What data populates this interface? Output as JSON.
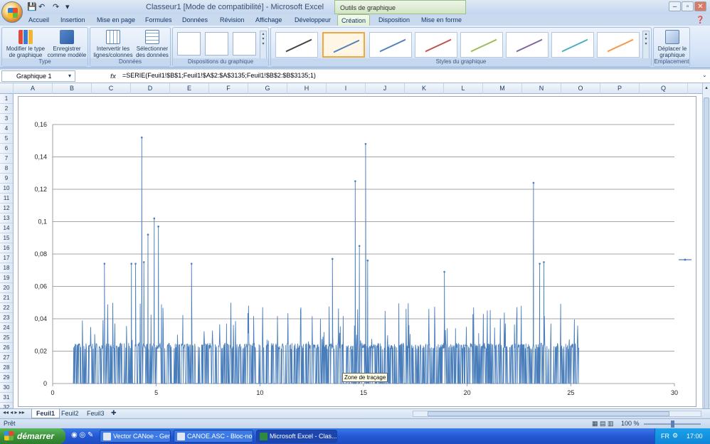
{
  "window": {
    "title": "Classeur1  [Mode de compatibilité] - Microsoft Excel",
    "context_tools": "Outils de graphique"
  },
  "tabs": [
    "Accueil",
    "Insertion",
    "Mise en page",
    "Formules",
    "Données",
    "Révision",
    "Affichage",
    "Développeur",
    "Création",
    "Disposition",
    "Mise en forme"
  ],
  "active_tab": "Création",
  "ribbon": {
    "type": {
      "title": "Type",
      "change_type": "Modifier le type de graphique",
      "save_template": "Enregistrer comme modèle"
    },
    "data": {
      "title": "Données",
      "switch": "Intervertir les lignes/colonnes",
      "select": "Sélectionner des données"
    },
    "layouts": {
      "title": "Dispositions du graphique"
    },
    "styles": {
      "title": "Styles du graphique",
      "colors": [
        "#404040",
        "#4f81bd",
        "#4f81bd",
        "#c0504d",
        "#9bbb59",
        "#8064a2",
        "#4bacc6",
        "#f79646"
      ]
    },
    "location": {
      "title": "Emplacement",
      "move": "Déplacer le graphique"
    }
  },
  "formula_bar": {
    "name_box": "Graphique 1",
    "fx": "fx",
    "formula": "=SERIE(Feuil1!$B$1;Feuil1!$A$2:$A$3135;Feuil1!$B$2:$B$3135;1)"
  },
  "columns": [
    "A",
    "B",
    "C",
    "D",
    "E",
    "F",
    "G",
    "H",
    "I",
    "J",
    "K",
    "L",
    "M",
    "N",
    "O",
    "P",
    "Q"
  ],
  "rows": [
    "1",
    "2",
    "3",
    "4",
    "5",
    "6",
    "7",
    "8",
    "9",
    "10",
    "11",
    "12",
    "13",
    "14",
    "15",
    "16",
    "17",
    "18",
    "19",
    "20",
    "21",
    "22",
    "23",
    "24",
    "25",
    "26",
    "27",
    "28",
    "29",
    "30",
    "31",
    "32"
  ],
  "sheet_tabs": [
    "Feuil1",
    "Feuil2",
    "Feuil3"
  ],
  "status": {
    "ready": "Prêt",
    "zoom": "100 %"
  },
  "taskbar": {
    "start": "démarrer",
    "tasks": [
      "Vector CANoe - Gen...",
      "CANOE.ASC - Bloc-no...",
      "Microsoft Excel - Clas..."
    ],
    "lang": "FR",
    "time": "17:00"
  },
  "tooltip": "Zone de traçage",
  "chart_data": {
    "type": "line",
    "x_ticks": [
      "0",
      "5",
      "10",
      "15",
      "20",
      "25",
      "30"
    ],
    "y_ticks": [
      "0",
      "0,02",
      "0,04",
      "0,06",
      "0,08",
      "0,1",
      "0,12",
      "0,14",
      "0,16"
    ],
    "xlim": [
      0,
      30
    ],
    "ylim": [
      0,
      0.16
    ],
    "grid": "horizontal",
    "x_range_data": [
      1.0,
      25.4
    ],
    "series": [
      {
        "color": "#4a7ebb",
        "peaks": [
          {
            "x": 4.3,
            "y": 0.152
          },
          {
            "x": 14.6,
            "y": 0.125
          },
          {
            "x": 14.8,
            "y": 0.085
          },
          {
            "x": 15.1,
            "y": 0.148
          },
          {
            "x": 23.2,
            "y": 0.124
          },
          {
            "x": 4.9,
            "y": 0.102
          },
          {
            "x": 5.1,
            "y": 0.097
          },
          {
            "x": 4.6,
            "y": 0.092
          },
          {
            "x": 4.0,
            "y": 0.074
          },
          {
            "x": 4.4,
            "y": 0.075
          },
          {
            "x": 2.5,
            "y": 0.074
          },
          {
            "x": 6.7,
            "y": 0.074
          },
          {
            "x": 13.5,
            "y": 0.077
          },
          {
            "x": 15.2,
            "y": 0.076
          },
          {
            "x": 18.9,
            "y": 0.069
          },
          {
            "x": 23.5,
            "y": 0.074
          },
          {
            "x": 23.7,
            "y": 0.075
          },
          {
            "x": 3.8,
            "y": 0.074
          }
        ],
        "typical_max": 0.05,
        "baseline_band": [
          0.0,
          0.025
        ]
      }
    ]
  }
}
